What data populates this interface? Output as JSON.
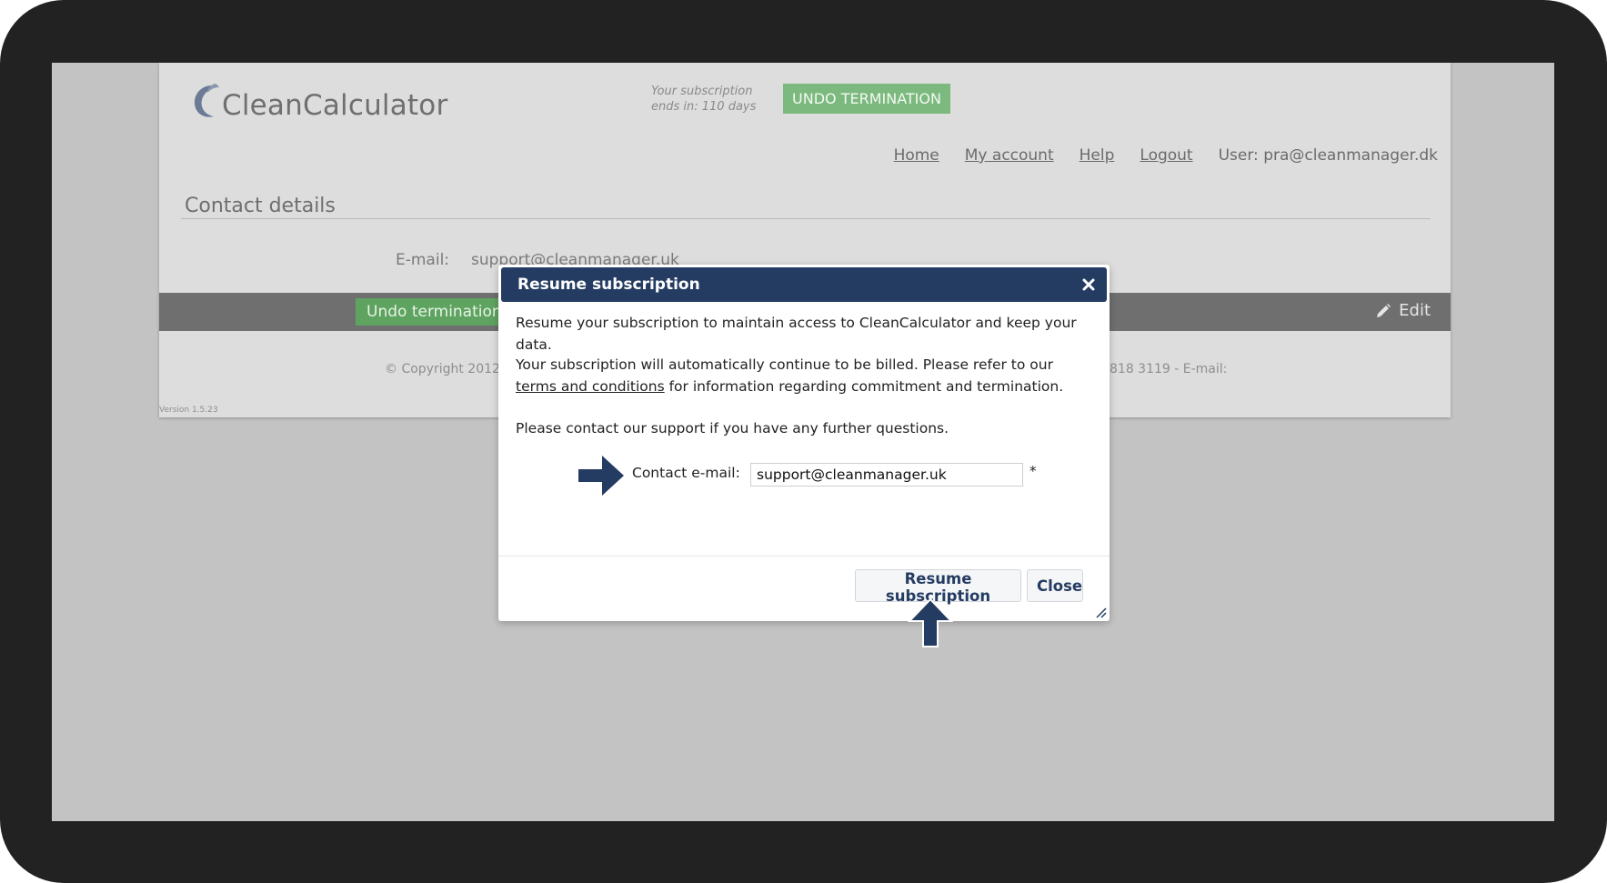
{
  "app": {
    "logo_text": "CleanCalculator"
  },
  "header": {
    "subscription_line1": "Your subscription",
    "subscription_line2": "ends in: 110 days",
    "undo_termination_label": "UNDO TERMINATION",
    "nav": {
      "home": "Home",
      "my_account": "My account",
      "help": "Help",
      "logout": "Logout",
      "user": "User: pra@cleanmanager.dk"
    }
  },
  "contact_details": {
    "title": "Contact details",
    "email_label": "E-mail:",
    "email_value": "support@cleanmanager.uk"
  },
  "action_bar": {
    "undo_label": "Undo termination",
    "edit_label": "Edit"
  },
  "footer": {
    "copyright_left": "© Copyright 2012-",
    "copyright_right": "818 3119 - E-mail:",
    "version": "Version 1.5.23"
  },
  "dialog": {
    "title": "Resume subscription",
    "paragraph1": "Resume your subscription to maintain access to CleanCalculator and keep your data.",
    "paragraph2_before": "Your subscription will automatically continue to be billed. Please refer to our ",
    "paragraph2_link": "terms and conditions",
    "paragraph2_after": " for information regarding commitment and termination.",
    "paragraph3": "Please contact our support if you have any further questions.",
    "contact_label": "Contact e-mail:",
    "contact_value": "support@cleanmanager.uk",
    "required_mark": "*",
    "resume_button": "Resume subscription",
    "close_button": "Close"
  },
  "colors": {
    "dialog_header": "#253c62",
    "undo_green": "#7cb97e",
    "action_bar": "#6f6f6f",
    "annotation_arrow": "#253c62"
  }
}
